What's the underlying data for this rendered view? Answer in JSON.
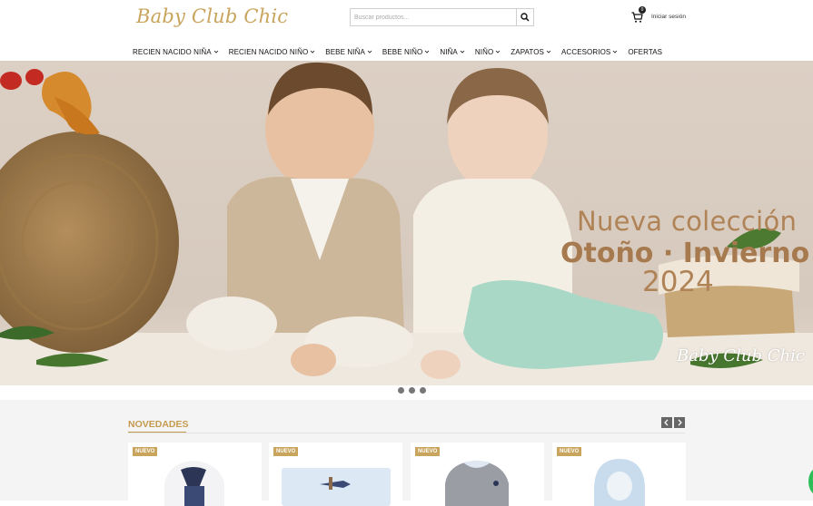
{
  "header": {
    "logo_text": "Baby Club Chic",
    "search_placeholder": "Buscar productos...",
    "cart_count": "0",
    "login_label": "Iniciar sesión"
  },
  "nav": {
    "items": [
      {
        "label": "RECIEN NACIDO NIÑA",
        "has_dropdown": true
      },
      {
        "label": "RECIEN NACIDO NIÑO",
        "has_dropdown": true
      },
      {
        "label": "BEBE NIÑA",
        "has_dropdown": true
      },
      {
        "label": "BEBE NIÑO",
        "has_dropdown": true
      },
      {
        "label": "NIÑA",
        "has_dropdown": true
      },
      {
        "label": "NIÑO",
        "has_dropdown": true
      },
      {
        "label": "ZAPATOS",
        "has_dropdown": true
      },
      {
        "label": "ACCESORIOS",
        "has_dropdown": true
      },
      {
        "label": "OFERTAS",
        "has_dropdown": false
      }
    ]
  },
  "hero": {
    "line1": "Nueva colección",
    "line2": "Otoño · Invierno",
    "line3": "2024",
    "brand": "Baby Club Chic",
    "slide_count": 3
  },
  "novedades": {
    "title": "NOVEDADES",
    "products": [
      {
        "badge": "NUEVO",
        "image": "baby-romper-navy"
      },
      {
        "badge": "NUEVO",
        "image": "blue-blanket-airplane"
      },
      {
        "badge": "NUEVO",
        "image": "grey-knit-romper"
      },
      {
        "badge": "NUEVO",
        "image": "light-blue-hooded-jacket"
      }
    ]
  },
  "colors": {
    "gold": "#c9a45c",
    "hero_text": "#b08356"
  }
}
